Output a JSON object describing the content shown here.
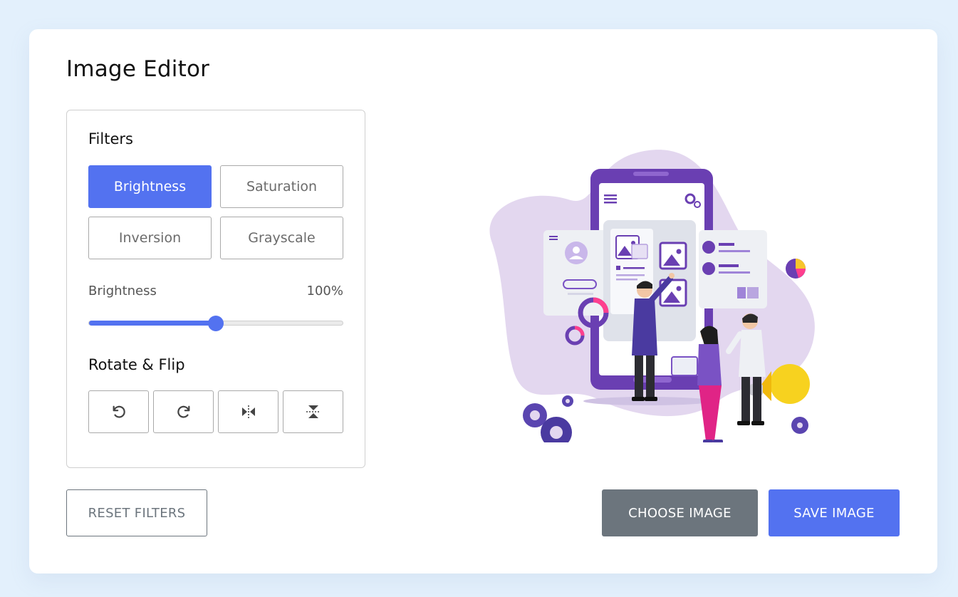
{
  "app": {
    "title": "Image Editor"
  },
  "filters": {
    "label": "Filters",
    "buttons": [
      {
        "label": "Brightness",
        "active": true
      },
      {
        "label": "Saturation",
        "active": false
      },
      {
        "label": "Inversion",
        "active": false
      },
      {
        "label": "Grayscale",
        "active": false
      }
    ]
  },
  "slider": {
    "name": "Brightness",
    "value_text": "100%",
    "fraction": 0.5
  },
  "rotate_flip": {
    "label": "Rotate & Flip",
    "buttons": [
      {
        "icon": "rotate-left-icon"
      },
      {
        "icon": "rotate-right-icon"
      },
      {
        "icon": "flip-horizontal-icon"
      },
      {
        "icon": "flip-vertical-icon"
      }
    ]
  },
  "actions": {
    "reset": "RESET FILTERS",
    "choose": "CHOOSE IMAGE",
    "save": "SAVE IMAGE"
  },
  "colors": {
    "accent": "#5372f0",
    "secondary": "#6c757d",
    "background": "#e3f0fc"
  },
  "preview": {
    "illustration": "team-mobile-app-illustration"
  }
}
